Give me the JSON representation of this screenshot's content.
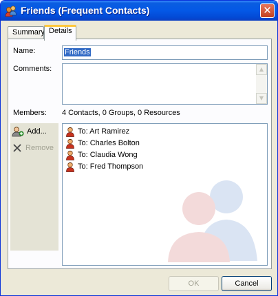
{
  "window": {
    "title": "Friends (Frequent Contacts)",
    "close_glyph": "✕"
  },
  "tabs": [
    {
      "label": "Summary",
      "active": false
    },
    {
      "label": "Details",
      "active": true
    }
  ],
  "details": {
    "name_label": "Name:",
    "name_value": "Friends",
    "comments_label": "Comments:",
    "comments_value": "",
    "members_label": "Members:",
    "members_summary": "4 Contacts, 0 Groups, 0 Resources"
  },
  "sidebar": {
    "add_label": "Add...",
    "remove_label": "Remove",
    "remove_enabled": false
  },
  "members": [
    {
      "text": "To: Art Ramirez",
      "icon": "contact-person-icon"
    },
    {
      "text": "To: Charles Bolton",
      "icon": "contact-person-icon"
    },
    {
      "text": "To: Claudia Wong",
      "icon": "contact-person-icon"
    },
    {
      "text": "To: Fred Thompson",
      "icon": "contact-person-icon"
    }
  ],
  "buttons": {
    "ok_label": "OK",
    "ok_enabled": false,
    "cancel_label": "Cancel"
  },
  "colors": {
    "titlebar": "#0458e6",
    "selection": "#316ac5",
    "tab_highlight": "#ffc83c",
    "close_button": "#c4411f"
  }
}
